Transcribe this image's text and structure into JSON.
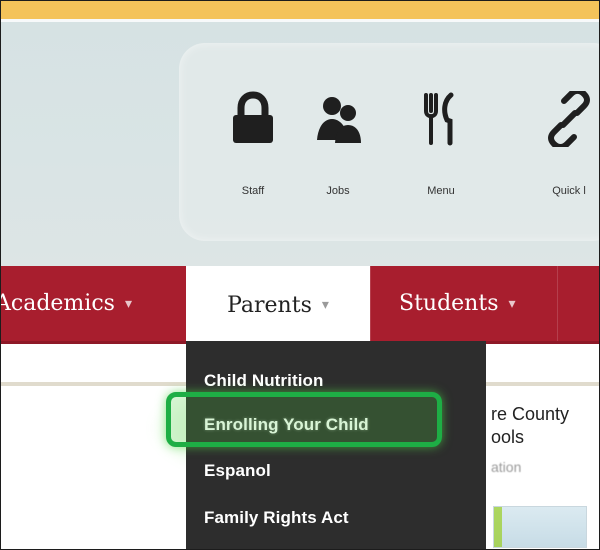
{
  "header": {
    "quick_links": [
      {
        "label": "Staff",
        "icon": "lock-icon"
      },
      {
        "label": "Jobs",
        "icon": "users-icon"
      },
      {
        "label": "Menu",
        "icon": "utensils-icon"
      },
      {
        "label": "Quick l",
        "icon": "link-icon"
      }
    ]
  },
  "nav": {
    "items": [
      {
        "label": "Academics"
      },
      {
        "label": "Parents"
      },
      {
        "label": "Students"
      }
    ],
    "caret": "▾"
  },
  "parents_menu": {
    "items": [
      {
        "label": "Child Nutrition"
      },
      {
        "label": "Enrolling Your Child"
      },
      {
        "label": "Espanol"
      },
      {
        "label": "Family Rights Act"
      }
    ]
  },
  "content": {
    "title": "re County\nools",
    "subtitle": "ation"
  },
  "colors": {
    "top_strip": "#f4c35a",
    "nav_background": "#a81e2e",
    "dropdown_background": "#2d2d2d",
    "highlight": "#1eae45"
  }
}
